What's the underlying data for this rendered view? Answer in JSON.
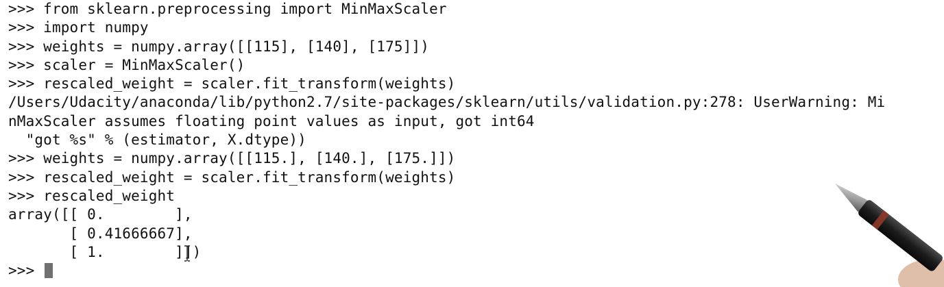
{
  "terminal": {
    "lines": [
      ">>> from sklearn.preprocessing import MinMaxScaler",
      ">>> import numpy",
      ">>> weights = numpy.array([[115], [140], [175]])",
      ">>> scaler = MinMaxScaler()",
      ">>> rescaled_weight = scaler.fit_transform(weights)",
      "/Users/Udacity/anaconda/lib/python2.7/site-packages/sklearn/utils/validation.py:278: UserWarning: Mi",
      "nMaxScaler assumes floating point values as input, got int64",
      "  \"got %s\" % (estimator, X.dtype))",
      ">>> weights = numpy.array([[115.], [140.], [175.]])",
      ">>> rescaled_weight = scaler.fit_transform(weights)",
      ">>> rescaled_weight",
      "array([[ 0.        ],",
      "       [ 0.41666667],",
      "       [ 1.        ]])"
    ],
    "prompt": ">>> "
  },
  "icons": {
    "cursor": "i-beam-cursor-icon",
    "pen": "stylus-pen"
  },
  "colors": {
    "background": "#ffffff",
    "text": "#111111",
    "caret": "#707070"
  }
}
